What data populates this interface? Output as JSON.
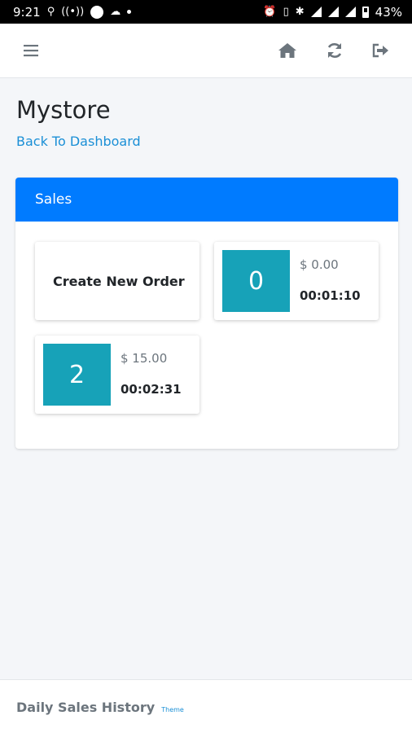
{
  "status_bar": {
    "time": "9:21",
    "battery": "43%"
  },
  "navbar": {
    "icons": [
      "menu-icon",
      "home-icon",
      "refresh-icon",
      "logout-icon"
    ]
  },
  "page": {
    "title": "Mystore",
    "back_link": "Back To Dashboard"
  },
  "sales_card": {
    "header": "Sales",
    "create_order_label": "Create New Order",
    "orders": [
      {
        "number": "0",
        "amount": "$ 0.00",
        "time": "00:01:10"
      },
      {
        "number": "2",
        "amount": "$ 15.00",
        "time": "00:02:31"
      }
    ]
  },
  "footer": {
    "title": "Daily Sales History",
    "theme_link": "Theme"
  },
  "colors": {
    "primary": "#007bff",
    "tile_teal": "#17a2b8",
    "link": "#1a8fd6",
    "background": "#f4f6f9"
  }
}
